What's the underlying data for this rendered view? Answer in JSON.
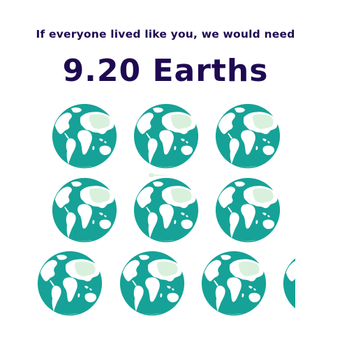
{
  "header": {
    "subtitle": "If everyone lived like you, we would need",
    "headline": "9.20 Earths"
  },
  "earths": {
    "count": 9.2,
    "icon": "earth-globe-icon"
  },
  "colors": {
    "text": "#1f0a52",
    "ocean": "#16a297",
    "land": "#ffffff",
    "highlight": "#d9f1dc"
  }
}
